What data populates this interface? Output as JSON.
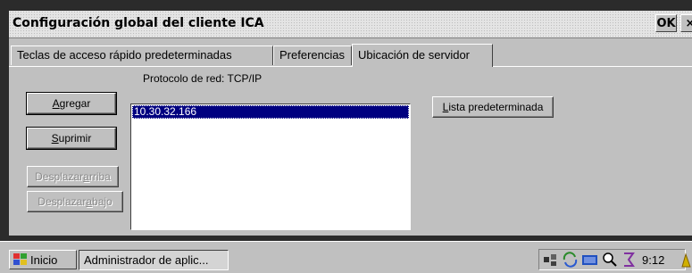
{
  "window": {
    "title": "Configuración global del cliente ICA",
    "ok_label": "OK",
    "close_label": "×"
  },
  "tabs": [
    {
      "label": "Teclas de acceso rápido predeterminadas",
      "active": false
    },
    {
      "label": "Preferencias",
      "active": false
    },
    {
      "label": "Ubicación de servidor",
      "active": true
    }
  ],
  "panel": {
    "protocol_label": "Protocolo de red: TCP/IP",
    "buttons": {
      "add": {
        "prefix": "",
        "accel": "A",
        "rest": "gregar"
      },
      "delete": {
        "prefix": "",
        "accel": "S",
        "rest": "uprimir"
      },
      "move_up": {
        "prefix": "Desplazar ",
        "accel": "a",
        "rest": "rriba"
      },
      "move_down": {
        "prefix": "Desplazar ",
        "accel": "a",
        "rest": "bajo"
      },
      "default_list": {
        "prefix": "",
        "accel": "L",
        "rest": "ista predeterminada"
      }
    },
    "server_list": [
      "10.30.32.166"
    ]
  },
  "taskbar": {
    "start_label": "Inicio",
    "task_label": "Administrador de aplic...",
    "clock": "9:12",
    "tray_icons": [
      "network-icon",
      "sync-icon",
      "keyboard-icon",
      "magnifier-icon",
      "input-method-icon"
    ]
  }
}
